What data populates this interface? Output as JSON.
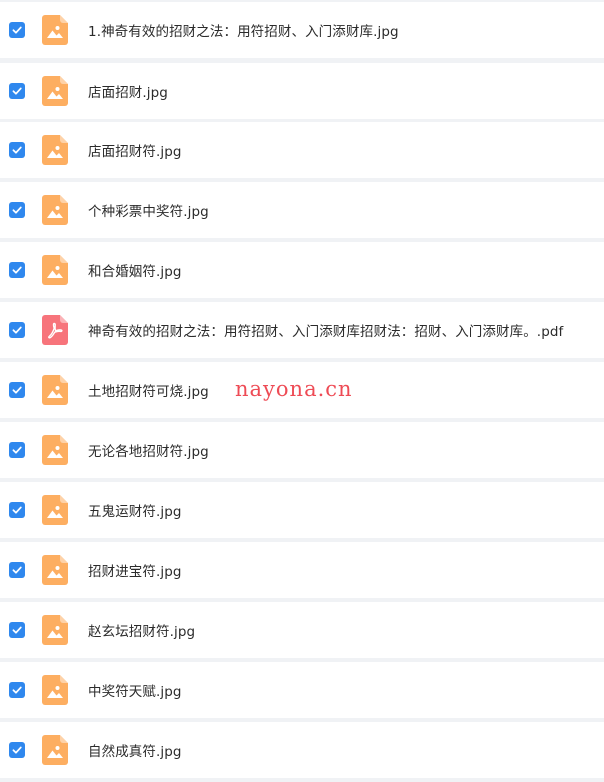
{
  "colors": {
    "checkbox": "#2f88ee",
    "image_icon": "#fdae61",
    "pdf_icon": "#f7747b",
    "background": "#f0f2f5",
    "watermark": "#ee4b55"
  },
  "files": [
    {
      "name": "1.神奇有效的招财之法：用符招财、入门添财库.jpg",
      "icon": "image-file-icon",
      "checked": true
    },
    {
      "name": "店面招财.jpg",
      "icon": "image-file-icon",
      "checked": true
    },
    {
      "name": "店面招财符.jpg",
      "icon": "image-file-icon",
      "checked": true
    },
    {
      "name": "个种彩票中奖符.jpg",
      "icon": "image-file-icon",
      "checked": true
    },
    {
      "name": "和合婚姻符.jpg",
      "icon": "image-file-icon",
      "checked": true
    },
    {
      "name": "神奇有效的招财之法：用符招财、入门添财库招财法：招财、入门添财库。.pdf",
      "icon": "pdf-file-icon",
      "checked": true
    },
    {
      "name": "土地招财符可烧.jpg",
      "icon": "image-file-icon",
      "checked": true
    },
    {
      "name": "无论各地招财符.jpg",
      "icon": "image-file-icon",
      "checked": true
    },
    {
      "name": "五鬼运财符.jpg",
      "icon": "image-file-icon",
      "checked": true
    },
    {
      "name": "招财进宝符.jpg",
      "icon": "image-file-icon",
      "checked": true
    },
    {
      "name": "赵玄坛招财符.jpg",
      "icon": "image-file-icon",
      "checked": true
    },
    {
      "name": "中奖符天赋.jpg",
      "icon": "image-file-icon",
      "checked": true
    },
    {
      "name": "自然成真符.jpg",
      "icon": "image-file-icon",
      "checked": true
    }
  ],
  "watermark": "nayona.cn"
}
